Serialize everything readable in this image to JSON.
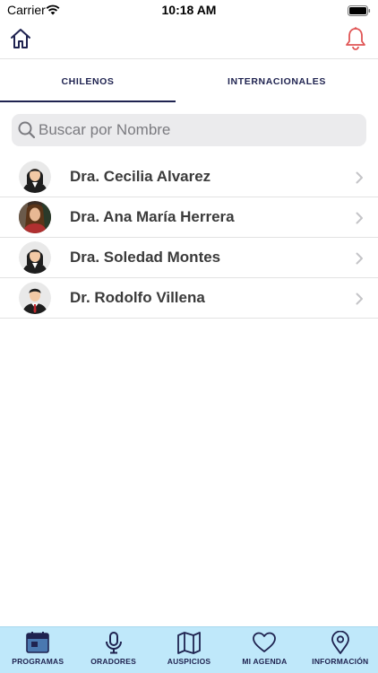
{
  "status_bar": {
    "carrier": "Carrier",
    "time": "10:18 AM"
  },
  "tabs": [
    {
      "label": "CHILENOS",
      "selected": true
    },
    {
      "label": "INTERNACIONALES",
      "selected": false
    }
  ],
  "search": {
    "placeholder": "Buscar por Nombre",
    "value": ""
  },
  "speakers": [
    {
      "name": "Dra. Cecilia Alvarez",
      "avatar": "female-avatar"
    },
    {
      "name": "Dra. Ana María Herrera",
      "avatar": "photo-avatar"
    },
    {
      "name": "Dra. Soledad Montes",
      "avatar": "female-avatar"
    },
    {
      "name": "Dr. Rodolfo Villena",
      "avatar": "male-avatar"
    }
  ],
  "tab_bar": [
    {
      "label": "PROGRAMAS",
      "icon": "calendar-icon"
    },
    {
      "label": "ORADORES",
      "icon": "microphone-icon"
    },
    {
      "label": "AUSPICIOS",
      "icon": "map-icon"
    },
    {
      "label": "MI AGENDA",
      "icon": "heart-icon"
    },
    {
      "label": "INFORMACIÓN",
      "icon": "location-pin-icon"
    }
  ],
  "colors": {
    "navy": "#1f2350",
    "bell": "#e05555",
    "tab_bar_bg": "#bfe8fa"
  }
}
